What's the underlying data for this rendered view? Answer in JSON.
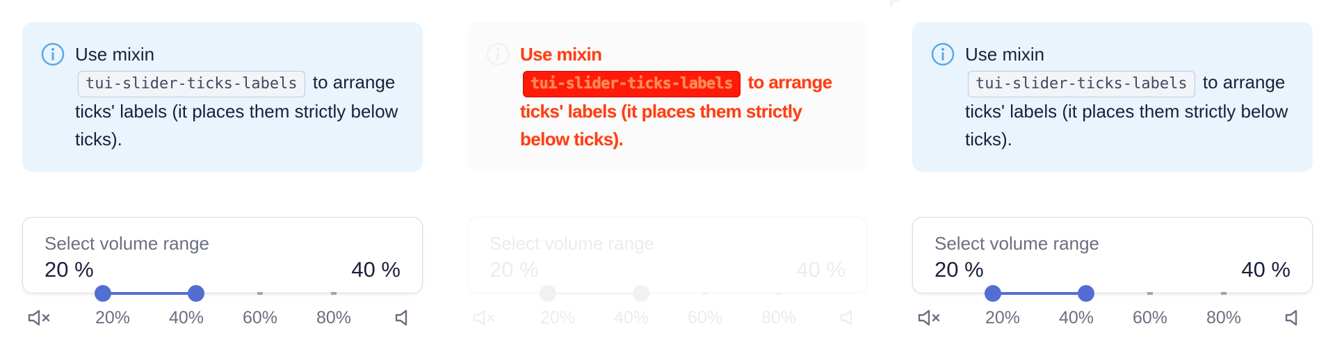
{
  "panels": [
    {
      "note": {
        "lead": "Use mixin",
        "code": "tui-slider-ticks-labels",
        "tail": " to arrange ticks' labels (it places them strictly below ticks)."
      },
      "slider": {
        "label": "Select volume range",
        "value_left": "20 %",
        "value_right": "40 %",
        "range_from": 0.25,
        "range_to": 0.5
      },
      "ticks": [
        "20%",
        "40%",
        "60%",
        "80%"
      ]
    },
    {
      "note": {
        "lead": "Use mixin",
        "code": "tui-slider-ticks-labels",
        "tail": " to arrange ticks' labels (it places them strictly below ticks)."
      },
      "slider": {
        "label": "Select volume range",
        "value_left": "20 %",
        "value_right": "40 %",
        "range_from": 0.25,
        "range_to": 0.5
      },
      "ticks": [
        "20%",
        "40%",
        "60%",
        "80%"
      ]
    },
    {
      "note": {
        "lead": "Use mixin",
        "code": "tui-slider-ticks-labels",
        "tail": " to arrange ticks' labels (it places them strictly below ticks)."
      },
      "slider": {
        "label": "Select volume range",
        "value_left": "20 %",
        "value_right": "40 %",
        "range_from": 0.25,
        "range_to": 0.5
      },
      "ticks": [
        "20%",
        "40%",
        "60%",
        "80%"
      ]
    }
  ],
  "icons": {
    "info": "info-icon",
    "mute": "volume-mute-icon",
    "volume": "volume-icon"
  },
  "colors": {
    "accent": "#526ed3",
    "note_bg": "#eaf4fd",
    "info_blue": "#5aa9e6"
  }
}
